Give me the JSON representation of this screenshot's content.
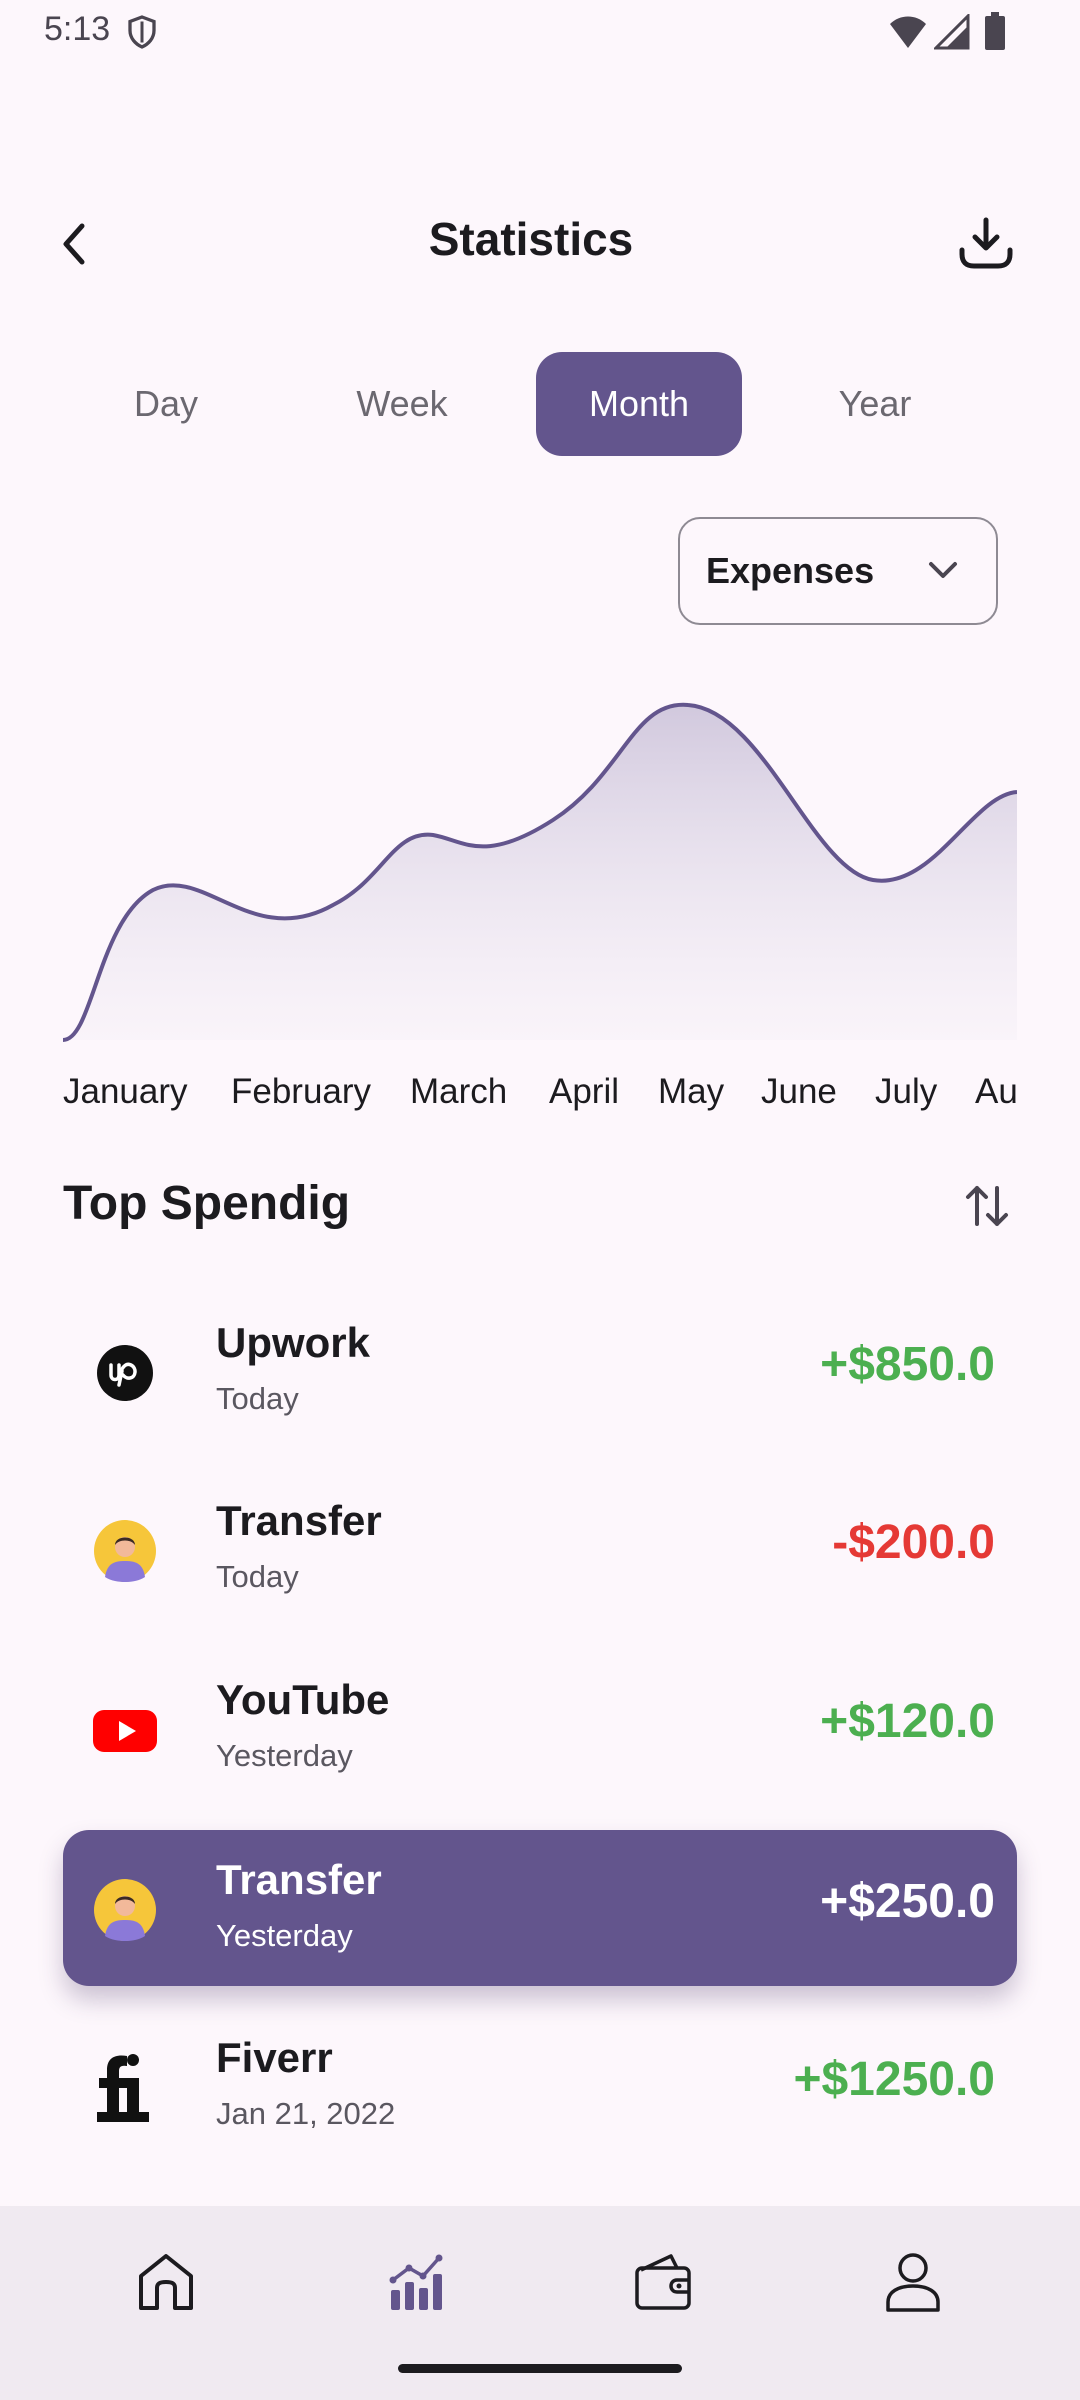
{
  "status_bar": {
    "time": "5:13"
  },
  "header": {
    "title": "Statistics"
  },
  "period_tabs": [
    {
      "label": "Day",
      "active": false
    },
    {
      "label": "Week",
      "active": false
    },
    {
      "label": "Month",
      "active": true
    },
    {
      "label": "Year",
      "active": false
    }
  ],
  "filter": {
    "selected": "Expenses"
  },
  "chart_data": {
    "type": "area",
    "categories": [
      "January",
      "February",
      "March",
      "April",
      "May",
      "June",
      "July",
      "Au"
    ],
    "line_color": "#63558d",
    "fill_color": "#d7d0e2",
    "grid": false
  },
  "top_spending": {
    "title": "Top Spendig",
    "items": [
      {
        "name": "Upwork",
        "date": "Today",
        "amount": "+$850.0",
        "type": "income",
        "logo": "upwork-logo"
      },
      {
        "name": "Transfer",
        "date": "Today",
        "amount": "-$200.0",
        "type": "expense",
        "logo": "person-avatar"
      },
      {
        "name": "YouTube",
        "date": "Yesterday",
        "amount": "+$120.0",
        "type": "income",
        "logo": "youtube-logo"
      },
      {
        "name": "Transfer",
        "date": "Yesterday",
        "amount": "+$250.0",
        "type": "income",
        "logo": "person-avatar",
        "highlighted": true
      },
      {
        "name": "Fiverr",
        "date": "Jan 21, 2022",
        "amount": "+$1250.0",
        "type": "income",
        "logo": "fiverr-logo"
      }
    ]
  },
  "colors": {
    "accent": "#63558d",
    "income": "#4caf50",
    "expense": "#e53935",
    "background": "#fdf7fc"
  },
  "bottom_nav": [
    {
      "icon": "home-icon",
      "active": false
    },
    {
      "icon": "statistics-icon",
      "active": true
    },
    {
      "icon": "wallet-icon",
      "active": false
    },
    {
      "icon": "profile-icon",
      "active": false
    }
  ]
}
